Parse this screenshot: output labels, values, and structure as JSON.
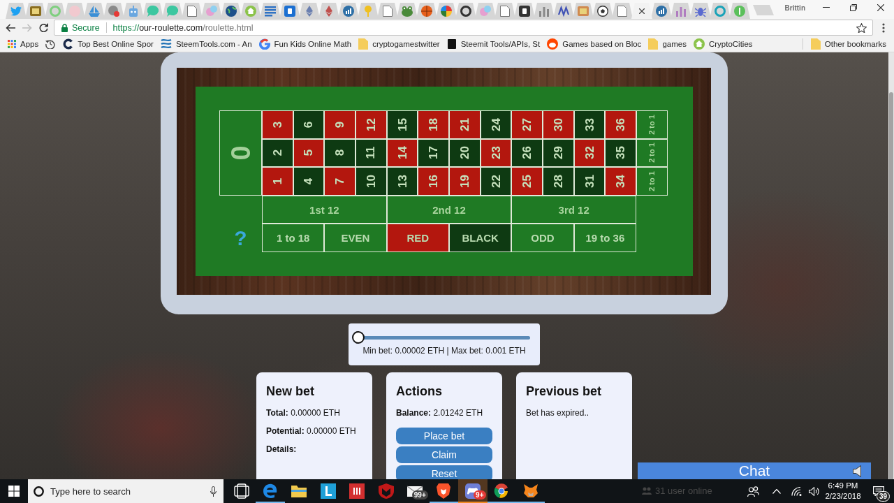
{
  "browser": {
    "tabs": [
      {
        "selected": false
      },
      {
        "selected": false
      },
      {
        "selected": false
      },
      {
        "selected": false
      },
      {
        "selected": false
      },
      {
        "selected": false
      },
      {
        "selected": false
      },
      {
        "selected": false
      },
      {
        "selected": false
      },
      {
        "selected": false
      },
      {
        "selected": false
      },
      {
        "selected": false
      },
      {
        "selected": false
      },
      {
        "selected": false
      },
      {
        "selected": false
      },
      {
        "selected": false
      },
      {
        "selected": false
      },
      {
        "selected": false
      },
      {
        "selected": false
      },
      {
        "selected": false
      },
      {
        "selected": false
      },
      {
        "selected": false
      },
      {
        "selected": false
      },
      {
        "selected": false
      },
      {
        "selected": false
      },
      {
        "selected": false
      },
      {
        "selected": false
      },
      {
        "selected": false
      },
      {
        "selected": false
      },
      {
        "selected": false
      },
      {
        "selected": false
      },
      {
        "selected": false
      },
      {
        "selected": true
      },
      {
        "selected": false
      },
      {
        "selected": false
      },
      {
        "selected": false
      },
      {
        "selected": false
      },
      {
        "selected": false
      }
    ],
    "profile_name": "Brittin",
    "address_bar": {
      "security_label": "Secure",
      "url": {
        "scheme": "https://",
        "host": "our-roulette.com",
        "path": "/roulette.html"
      }
    },
    "apps_label": "Apps",
    "bookmarks": [
      {
        "label": "Top Best Online Spor"
      },
      {
        "label": "SteemTools.com - An"
      },
      {
        "label": "Fun Kids Online Math"
      },
      {
        "label": "cryptogamestwitter"
      },
      {
        "label": "Steemit Tools/APIs, St"
      },
      {
        "label": "Games based on Bloc"
      },
      {
        "label": "games"
      },
      {
        "label": "CryptoCities"
      }
    ],
    "other_bookmarks": "Other bookmarks"
  },
  "roulette": {
    "zero": "0",
    "rows": [
      [
        {
          "label": "3",
          "color": "#b3170e"
        },
        {
          "label": "6",
          "color": "#0e3a12"
        },
        {
          "label": "9",
          "color": "#b3170e"
        },
        {
          "label": "12",
          "color": "#b3170e"
        },
        {
          "label": "15",
          "color": "#0e3a12"
        },
        {
          "label": "18",
          "color": "#b3170e"
        },
        {
          "label": "21",
          "color": "#b3170e"
        },
        {
          "label": "24",
          "color": "#0e3a12"
        },
        {
          "label": "27",
          "color": "#b3170e"
        },
        {
          "label": "30",
          "color": "#b3170e"
        },
        {
          "label": "33",
          "color": "#0e3a12"
        },
        {
          "label": "36",
          "color": "#b3170e"
        }
      ],
      [
        {
          "label": "2",
          "color": "#0e3a12"
        },
        {
          "label": "5",
          "color": "#b3170e"
        },
        {
          "label": "8",
          "color": "#0e3a12"
        },
        {
          "label": "11",
          "color": "#0e3a12"
        },
        {
          "label": "14",
          "color": "#b3170e"
        },
        {
          "label": "17",
          "color": "#0e3a12"
        },
        {
          "label": "20",
          "color": "#0e3a12"
        },
        {
          "label": "23",
          "color": "#b3170e"
        },
        {
          "label": "26",
          "color": "#0e3a12"
        },
        {
          "label": "29",
          "color": "#0e3a12"
        },
        {
          "label": "32",
          "color": "#b3170e"
        },
        {
          "label": "35",
          "color": "#0e3a12"
        }
      ],
      [
        {
          "label": "1",
          "color": "#b3170e"
        },
        {
          "label": "4",
          "color": "#0e3a12"
        },
        {
          "label": "7",
          "color": "#b3170e"
        },
        {
          "label": "10",
          "color": "#0e3a12"
        },
        {
          "label": "13",
          "color": "#0e3a12"
        },
        {
          "label": "16",
          "color": "#b3170e"
        },
        {
          "label": "19",
          "color": "#b3170e"
        },
        {
          "label": "22",
          "color": "#0e3a12"
        },
        {
          "label": "25",
          "color": "#b3170e"
        },
        {
          "label": "28",
          "color": "#0e3a12"
        },
        {
          "label": "31",
          "color": "#0e3a12"
        },
        {
          "label": "34",
          "color": "#b3170e"
        }
      ]
    ],
    "column_bets": [
      "2 to 1",
      "2 to 1",
      "2 to 1"
    ],
    "dozens": [
      "1st 12",
      "2nd 12",
      "3rd 12"
    ],
    "outside_bets": [
      {
        "label": "1 to 18",
        "color": "#1f7a24"
      },
      {
        "label": "EVEN",
        "color": "#1f7a24"
      },
      {
        "label": "RED",
        "color": "#b3170e"
      },
      {
        "label": "BLACK",
        "color": "#0e3a12"
      },
      {
        "label": "ODD",
        "color": "#1f7a24"
      },
      {
        "label": "19 to 36",
        "color": "#1f7a24"
      }
    ],
    "help": "?"
  },
  "bet_slider": {
    "level": 0,
    "limits": "Min bet: 0.00002 ETH | Max bet: 0.001 ETH"
  },
  "panels": [
    {
      "title": "New bet",
      "lines": [
        {
          "label": "Total:",
          "value": "0.00000 ETH"
        },
        {
          "label": "Potential:",
          "value": "0.00000 ETH"
        },
        {
          "label": "Details:"
        }
      ]
    },
    {
      "title": "Actions",
      "lines": [
        {
          "label": "Balance:",
          "value": "2.01242 ETH"
        }
      ],
      "buttons": [
        "Place bet",
        "Claim",
        "Reset"
      ]
    },
    {
      "title": "Previous bet",
      "lines": [
        {
          "value": "Bet has expired.."
        }
      ]
    }
  ],
  "chat": {
    "title": "Chat",
    "status": "31 user online"
  },
  "taskbar": {
    "search": {
      "placeholder": "Type here to search"
    },
    "apps": [
      {
        "running": false,
        "flashing": false
      },
      {
        "running": true,
        "flashing": false
      },
      {
        "running": false,
        "flashing": false
      },
      {
        "running": false,
        "flashing": false
      },
      {
        "running": false,
        "flashing": false
      },
      {
        "running": false,
        "flashing": false
      },
      {
        "running": false,
        "flashing": false,
        "badge": "99+"
      },
      {
        "running": true,
        "flashing": false
      },
      {
        "running": true,
        "flashing": true,
        "badge": "9+"
      },
      {
        "running": true,
        "flashing": false
      },
      {
        "running": true,
        "flashing": false
      }
    ],
    "clock": {
      "time": "6:49 PM",
      "date": "2/23/2018"
    },
    "notifications": {
      "count": "39"
    }
  }
}
